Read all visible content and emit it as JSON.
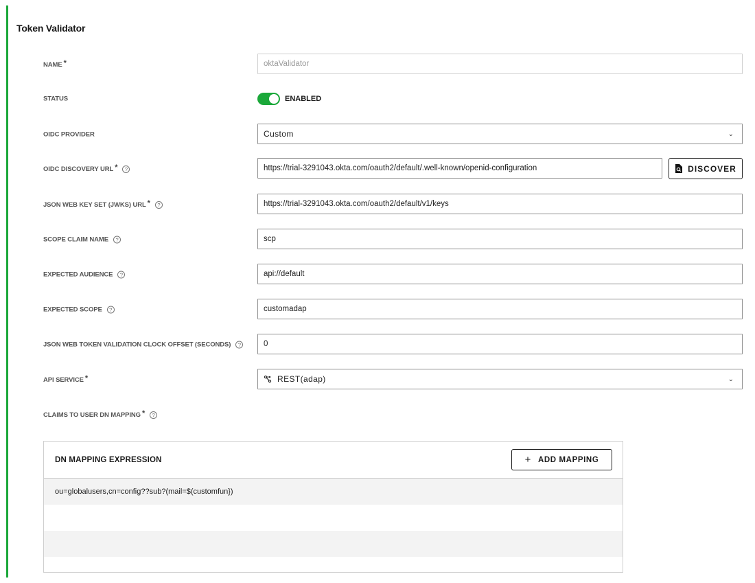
{
  "page": {
    "title": "Token Validator",
    "accent_color": "#1ba83a"
  },
  "fields": {
    "name": {
      "label": "NAME",
      "required": "*",
      "value": "oktaValidator"
    },
    "status": {
      "label": "STATUS",
      "toggle_text": "ENABLED",
      "enabled": true
    },
    "oidc_provider": {
      "label": "OIDC PROVIDER",
      "value": "Custom"
    },
    "oidc_discovery_url": {
      "label": "OIDC DISCOVERY URL",
      "required": "*",
      "value": "https://trial-3291043.okta.com/oauth2/default/.well-known/openid-configuration",
      "button": "DISCOVER"
    },
    "jwks_url": {
      "label": "JSON WEB KEY SET (JWKS) URL",
      "required": "*",
      "value": "https://trial-3291043.okta.com/oauth2/default/v1/keys"
    },
    "scope_claim_name": {
      "label": "SCOPE CLAIM NAME",
      "value": "scp"
    },
    "expected_audience": {
      "label": "EXPECTED AUDIENCE",
      "value": "api://default"
    },
    "expected_scope": {
      "label": "EXPECTED SCOPE",
      "value": "customadap"
    },
    "clock_offset": {
      "label": "JSON WEB TOKEN VALIDATION CLOCK OFFSET (SECONDS)",
      "value": "0"
    },
    "api_service": {
      "label": "API SERVICE",
      "required": "*",
      "value": "REST(adap)"
    },
    "claims_mapping": {
      "label": "CLAIMS TO USER DN MAPPING",
      "required": "*"
    }
  },
  "help_glyph": "?",
  "chevron_glyph": "⌄",
  "mapping_table": {
    "header": "DN MAPPING EXPRESSION",
    "add_button": "ADD MAPPING",
    "plus_glyph": "+",
    "rows": [
      "ou=globalusers,cn=config??sub?(mail=$(customfun})",
      "",
      "",
      ""
    ]
  }
}
